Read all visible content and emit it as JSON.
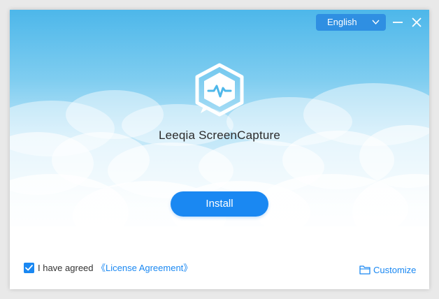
{
  "window": {
    "app_name": "Leeqia ScreenCapture"
  },
  "titlebar": {
    "language_selected": "English",
    "icons": {
      "dropdown": "chevron-down-icon",
      "minimize": "minimize-icon",
      "close": "close-icon"
    }
  },
  "main": {
    "logo_icon": "app-logo-icon",
    "install_label": "Install"
  },
  "footer": {
    "agree_checked": true,
    "agree_text": "I have agreed",
    "license_link": "《License Agreement》",
    "customize_label": "Customize",
    "customize_icon": "folder-icon"
  },
  "colors": {
    "sky_top": "#4fb8ea",
    "accent": "#1a88f2",
    "dropdown_bg": "#2f8fe2",
    "text": "#2b2b2b"
  }
}
